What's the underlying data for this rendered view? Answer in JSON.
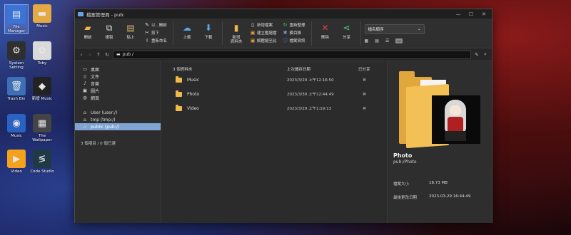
{
  "desktop": {
    "icons": [
      {
        "label": "File Manager",
        "glyph": "▤",
        "color": "#3b74d8"
      },
      {
        "label": "Music",
        "glyph": "▬",
        "color": "#e4a943"
      },
      {
        "label": "System Setting",
        "glyph": "⚙",
        "color": "#2f2f2f"
      },
      {
        "label": "Toby",
        "glyph": "✿",
        "color": "#d9d9d9"
      },
      {
        "label": "Trash Bin",
        "glyph": "🗑",
        "color": "#3c6fb5"
      },
      {
        "label": "新增 Music",
        "glyph": "◆",
        "color": "#222"
      },
      {
        "label": "Music",
        "glyph": "◉",
        "color": "#2a62c4"
      },
      {
        "label": "The Wallpaper",
        "glyph": "▦",
        "color": "#444"
      },
      {
        "label": "Video",
        "glyph": "▶",
        "color": "#f4a21d"
      },
      {
        "label": "Code Studio",
        "glyph": "≶",
        "color": "#1f3a44"
      }
    ]
  },
  "window": {
    "title": "檔案管理員 - pub:",
    "controls": {
      "minimize": "—",
      "maximize": "☐",
      "close": "✕"
    }
  },
  "ribbon": {
    "open": "開啟",
    "copy": "複製",
    "paste": "貼上",
    "cut": "以...開啟",
    "cut2": "剪下",
    "rename": "重新命名",
    "upload": "上載",
    "download": "下載",
    "new_folder": "新增\n資料夾",
    "new_file": "新增檔案",
    "new_link": "建立壓縮檔",
    "extract": "解壓縮至此",
    "refresh": "重新整理",
    "select_all": "模目錄",
    "properties": "檔案資訊",
    "delete": "刪除",
    "share": "分享",
    "sort_label": "檔名順序",
    "view_icons": [
      "▦",
      "▤",
      "☰",
      "▭"
    ]
  },
  "pathbar": {
    "path": "pub /",
    "nav": {
      "back": "‹",
      "forward": "›",
      "up": "↑",
      "reload": "↻"
    }
  },
  "sidebar": {
    "places": [
      {
        "label": "桌面",
        "glyph": "▭"
      },
      {
        "label": "文件",
        "glyph": "▯"
      },
      {
        "label": "音樂",
        "glyph": "♪"
      },
      {
        "label": "圖片",
        "glyph": "▣"
      },
      {
        "label": "網頁",
        "glyph": "◍"
      }
    ],
    "drives": [
      {
        "label": "User (user:/)",
        "glyph": "⌂"
      },
      {
        "label": "tmp (tmp:/)",
        "glyph": "⌂"
      },
      {
        "label": "public (pub:/)",
        "glyph": "⌂"
      }
    ],
    "status": "3 個項目 / 0 個已選"
  },
  "filelist": {
    "header": {
      "name": "3 個資料夾",
      "modified": "上次儲存日期",
      "shared": "已分享"
    },
    "rows": [
      {
        "name": "Music",
        "modified": "2023/3/29 上午12:16:50",
        "shared": "✖"
      },
      {
        "name": "Photo",
        "modified": "2023/3/30 上午12:44:49",
        "shared": "✖"
      },
      {
        "name": "Video",
        "modified": "2023/3/29 上午1:19:13",
        "shared": "✖"
      }
    ]
  },
  "preview": {
    "title": "Photo",
    "path": "pub:/Photo",
    "size_label": "檔案大小",
    "size_value": "18.73 MB",
    "modified_label": "最後更改日期",
    "modified_value": "2023-03-29 16:44:49"
  }
}
